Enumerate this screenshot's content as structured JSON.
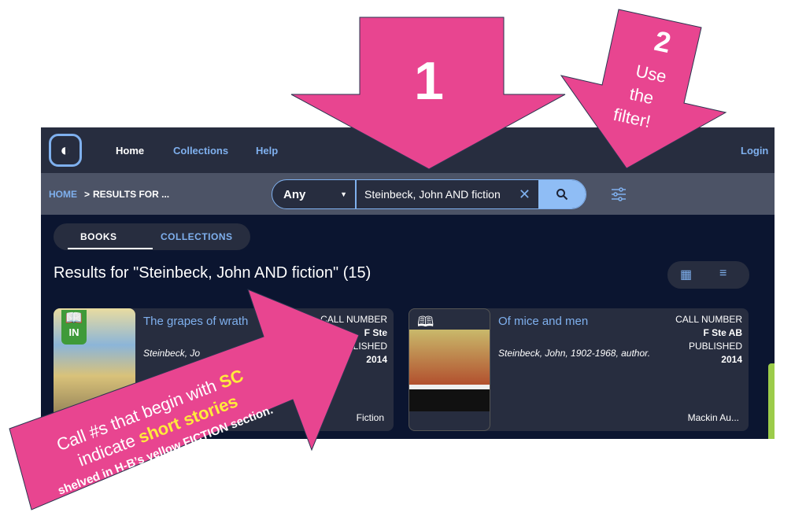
{
  "nav": {
    "home": "Home",
    "collections": "Collections",
    "help": "Help",
    "login": "Login"
  },
  "breadcrumb": {
    "home": "HOME",
    "sep": ">",
    "current": "RESULTS FOR ..."
  },
  "search": {
    "scope": "Any",
    "query": "Steinbeck, John AND fiction"
  },
  "tabs": [
    {
      "label": "BOOKS",
      "active": true
    },
    {
      "label": "COLLECTIONS",
      "active": false
    }
  ],
  "results": {
    "heading": "Results for \"Steinbeck, John AND fiction\" (15)"
  },
  "cards": [
    {
      "title": "The grapes of wrath",
      "author": "Steinbeck, Jo",
      "call_label": "CALL NUMBER",
      "call": "F Ste",
      "pub_label": "PUBLISHED",
      "year": "2014",
      "source": "Fiction",
      "badge": "IN",
      "format": "book-icon"
    },
    {
      "title": "Of mice and men",
      "author": "Steinbeck, John, 1902-1968, author.",
      "call_label": "CALL NUMBER",
      "call": "F Ste AB",
      "pub_label": "PUBLISHED",
      "year": "2014",
      "source": "Mackin Au...",
      "format": "audiobook-icon"
    }
  ],
  "annotations": {
    "arrow1": "1",
    "arrow2": {
      "num": "2",
      "line1": "Use",
      "line2": "the",
      "line3": "filter!"
    },
    "arrow3": {
      "line1a": "Call #s that begin with ",
      "line1b": "SC",
      "line2a": "indicate ",
      "line2b": "short stories",
      "line3": "shelved in H-B’s yellow FICTION section."
    }
  },
  "colors": {
    "annotation": "#e84590",
    "accent": "#7fb0ee",
    "highlight": "#ffeb3b",
    "badge": "#3f9a3a"
  }
}
